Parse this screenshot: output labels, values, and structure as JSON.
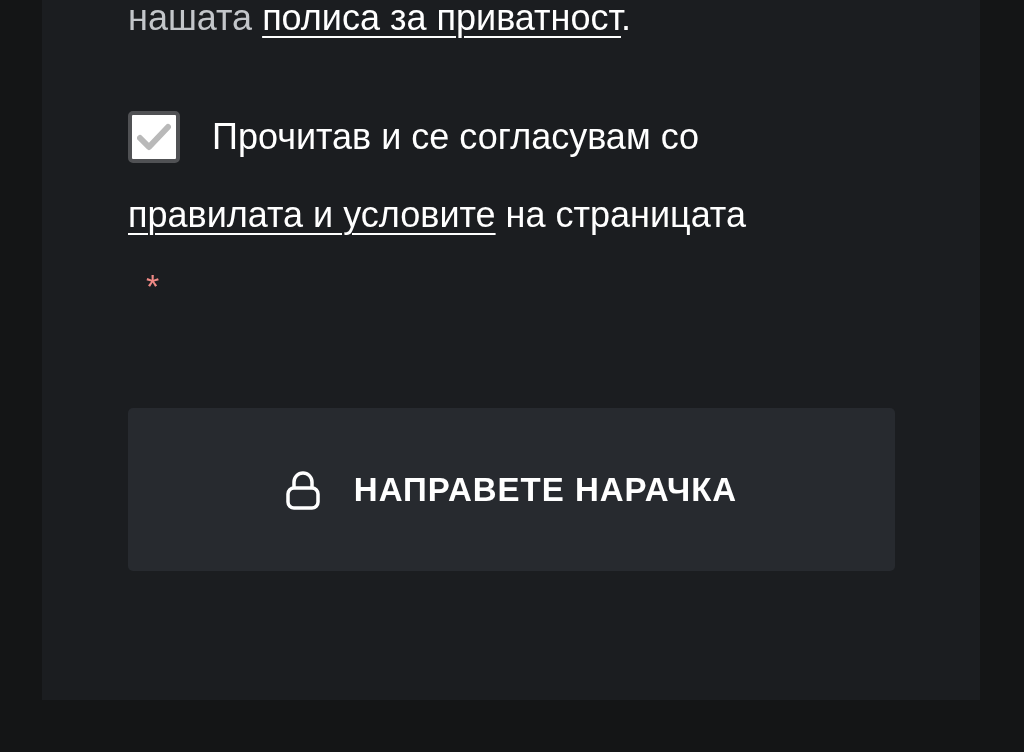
{
  "privacy_note": {
    "text": "нашата",
    "link": "полиса за приватност",
    "end": "."
  },
  "terms": {
    "checked": true,
    "text_before": "Прочитав и се согласувам со",
    "link": "правилата и условите",
    "text_after": "на страницата",
    "required_mark": "*"
  },
  "submit_button": {
    "label": "НАПРАВЕТЕ НАРАЧКА"
  }
}
